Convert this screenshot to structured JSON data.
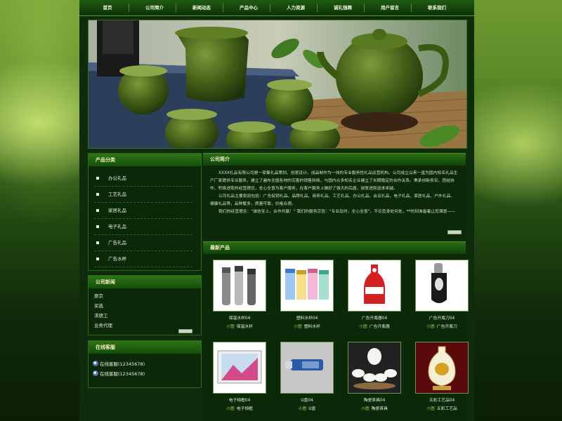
{
  "nav": {
    "items": [
      "首页",
      "公司简介",
      "新闻动态",
      "产品中心",
      "人力资源",
      "诚礼强聘",
      "用户留言",
      "联系我们"
    ]
  },
  "sidebar": {
    "category_title": "产品分类",
    "categories": [
      "办公礼品",
      "工艺礼品",
      "家居礼品",
      "电子礼品",
      "广告礼品",
      "广告水杯"
    ],
    "news_title": "公司新闻",
    "news": [
      "原京",
      "买逃",
      "求德工",
      "业务代理"
    ],
    "contact_title": "在线客服",
    "contacts": [
      "在线客服(12345678)",
      "在线客服(12345678)"
    ]
  },
  "about": {
    "title": "公司简介",
    "paragraphs": [
      "XXXX礼品有限公司是一家集礼品策划、创意设计、成品制作为一体的专业服务性礼品运营机构。公司成立以来一直为国内知名礼品生产厂家提供专业服务，建立了遍布全国各地的完善的销售网络，与国内众多知名企业建立了长期稳定的合作关系。秉承创新务实、团结协作、积极进取的经营理念，全心全意为客户服务，在客户服务上做好了强大的后盾，锐意进取追求卓越。",
      "公司礼品主要类别包括：广告促销礼品、品牌礼品、商务礼品、工艺礼品、办公礼品、会议礼品、电子礼品、家居礼品、户外礼品、健康礼品等，品种繁多，质量可靠，价格合理。",
      "我们的经营理念：\"诚信至上，合作共赢！\"  我们的服务宗旨：\"专业及时，全心全意\"，不论您身处何处，**时刻准备着让您满意——"
    ]
  },
  "products": {
    "title": "最新产品",
    "tag": "小图",
    "items": [
      {
        "name": "保温水杯04",
        "sub": "保温水杯"
      },
      {
        "name": "塑料水杯04",
        "sub": "塑料水杯"
      },
      {
        "name": "广告开瓶器04",
        "sub": "广告开瓶器"
      },
      {
        "name": "广告开瓶刀04",
        "sub": "广告开瓶刀"
      },
      {
        "name": "电子相框04",
        "sub": "电子相框"
      },
      {
        "name": "U盘04",
        "sub": "U盘"
      },
      {
        "name": "陶瓷茶具04",
        "sub": "陶瓷茶具"
      },
      {
        "name": "五彩工艺品04",
        "sub": "五彩工艺品"
      }
    ]
  },
  "colors": {
    "page_green": "#0e2c0b",
    "header_green": "#2f7516",
    "title_yellow": "#f2f0c0",
    "tag_green": "#8fd05a"
  }
}
